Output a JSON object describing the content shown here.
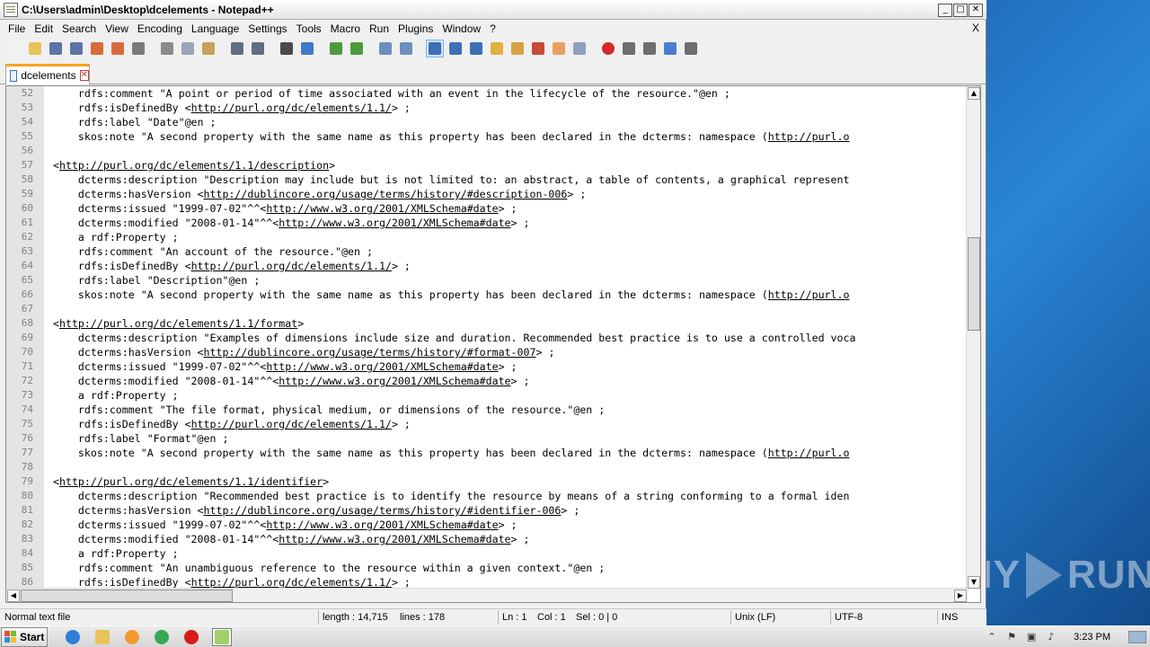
{
  "window": {
    "title": "C:\\Users\\admin\\Desktop\\dcelements - Notepad++",
    "buttons": {
      "minimize": "_",
      "maximize": "□",
      "close": "✕"
    }
  },
  "menubar": {
    "items": [
      "File",
      "Edit",
      "Search",
      "View",
      "Encoding",
      "Language",
      "Settings",
      "Tools",
      "Macro",
      "Run",
      "Plugins",
      "Window",
      "?"
    ],
    "close_doc": "X"
  },
  "toolbar": {
    "icons": [
      "new-file-icon",
      "open-file-icon",
      "save-icon",
      "save-all-icon",
      "close-icon",
      "close-all-icon",
      "print-icon",
      "sep",
      "cut-icon",
      "copy-icon",
      "paste-icon",
      "sep",
      "undo-icon",
      "redo-icon",
      "sep",
      "find-icon",
      "replace-icon",
      "sep",
      "zoom-in-icon",
      "zoom-out-icon",
      "sep",
      "sync-v-icon",
      "sync-h-icon",
      "sep",
      "word-wrap-icon",
      "all-chars-icon",
      "indent-guide-icon",
      "udl-icon",
      "doc-map-icon",
      "function-list-icon",
      "folder-workspace-icon",
      "monitor-icon",
      "sep",
      "record-macro-icon",
      "stop-macro-icon",
      "play-macro-icon",
      "run-multiple-macro-icon",
      "save-macro-icon"
    ],
    "colors": {
      "new-file-icon": "#f2f2f2",
      "open-file-icon": "#e8c35a",
      "save-icon": "#5a74a8",
      "save-all-icon": "#5a74a8",
      "close-icon": "#d86a3f",
      "close-all-icon": "#d86a3f",
      "print-icon": "#7a7a7a",
      "cut-icon": "#8a8a8a",
      "copy-icon": "#9aa6b8",
      "paste-icon": "#c7a05b",
      "undo-icon": "#5f6f86",
      "redo-icon": "#5f6f86",
      "find-icon": "#4a4a4a",
      "replace-icon": "#3f79c9",
      "zoom-in-icon": "#4e9a3c",
      "zoom-out-icon": "#4e9a3c",
      "sync-v-icon": "#6d8fbf",
      "sync-h-icon": "#6d8fbf",
      "word-wrap-icon": "#3e6fb4",
      "all-chars-icon": "#3e6fb4",
      "indent-guide-icon": "#3e6fb4",
      "udl-icon": "#e0b040",
      "doc-map-icon": "#d8a040",
      "function-list-icon": "#c74b3a",
      "folder-workspace-icon": "#e8a060",
      "monitor-icon": "#8fa0c0",
      "record-macro-icon": "#d42a2a",
      "stop-macro-icon": "#6e6e6e",
      "play-macro-icon": "#6e6e6e",
      "run-multiple-macro-icon": "#4a7fd0",
      "save-macro-icon": "#6e6e6e"
    }
  },
  "tab": {
    "label": "dcelements",
    "close": "✕"
  },
  "editor": {
    "lines": [
      {
        "n": "52",
        "t": "    rdfs:comment \"A point or period of time associated with an event in the lifecycle of the resource.\"@en ;"
      },
      {
        "n": "53",
        "t": "    rdfs:isDefinedBy <",
        "u": "http://purl.org/dc/elements/1.1/",
        "a": "> ;"
      },
      {
        "n": "54",
        "t": "    rdfs:label \"Date\"@en ;"
      },
      {
        "n": "55",
        "t": "    skos:note \"A second property with the same name as this property has been declared in the dcterms: namespace (",
        "u": "http://purl.o",
        "a": ""
      },
      {
        "n": "56",
        "t": ""
      },
      {
        "n": "57",
        "t": "<",
        "u": "http://purl.org/dc/elements/1.1/description",
        "a": ">"
      },
      {
        "n": "58",
        "t": "    dcterms:description \"Description may include but is not limited to: an abstract, a table of contents, a graphical represent"
      },
      {
        "n": "59",
        "t": "    dcterms:hasVersion <",
        "u": "http://dublincore.org/usage/terms/history/#description-006",
        "a": "> ;"
      },
      {
        "n": "60",
        "t": "    dcterms:issued \"1999-07-02\"^^<",
        "u": "http://www.w3.org/2001/XMLSchema#date",
        "a": "> ;"
      },
      {
        "n": "61",
        "t": "    dcterms:modified \"2008-01-14\"^^<",
        "u": "http://www.w3.org/2001/XMLSchema#date",
        "a": "> ;"
      },
      {
        "n": "62",
        "t": "    a rdf:Property ;"
      },
      {
        "n": "63",
        "t": "    rdfs:comment \"An account of the resource.\"@en ;"
      },
      {
        "n": "64",
        "t": "    rdfs:isDefinedBy <",
        "u": "http://purl.org/dc/elements/1.1/",
        "a": "> ;"
      },
      {
        "n": "65",
        "t": "    rdfs:label \"Description\"@en ;"
      },
      {
        "n": "66",
        "t": "    skos:note \"A second property with the same name as this property has been declared in the dcterms: namespace (",
        "u": "http://purl.o",
        "a": ""
      },
      {
        "n": "67",
        "t": ""
      },
      {
        "n": "68",
        "t": "<",
        "u": "http://purl.org/dc/elements/1.1/format",
        "a": ">"
      },
      {
        "n": "69",
        "t": "    dcterms:description \"Examples of dimensions include size and duration. Recommended best practice is to use a controlled voca"
      },
      {
        "n": "70",
        "t": "    dcterms:hasVersion <",
        "u": "http://dublincore.org/usage/terms/history/#format-007",
        "a": "> ;"
      },
      {
        "n": "71",
        "t": "    dcterms:issued \"1999-07-02\"^^<",
        "u": "http://www.w3.org/2001/XMLSchema#date",
        "a": "> ;"
      },
      {
        "n": "72",
        "t": "    dcterms:modified \"2008-01-14\"^^<",
        "u": "http://www.w3.org/2001/XMLSchema#date",
        "a": "> ;"
      },
      {
        "n": "73",
        "t": "    a rdf:Property ;"
      },
      {
        "n": "74",
        "t": "    rdfs:comment \"The file format, physical medium, or dimensions of the resource.\"@en ;"
      },
      {
        "n": "75",
        "t": "    rdfs:isDefinedBy <",
        "u": "http://purl.org/dc/elements/1.1/",
        "a": "> ;"
      },
      {
        "n": "76",
        "t": "    rdfs:label \"Format\"@en ;"
      },
      {
        "n": "77",
        "t": "    skos:note \"A second property with the same name as this property has been declared in the dcterms: namespace (",
        "u": "http://purl.o",
        "a": ""
      },
      {
        "n": "78",
        "t": ""
      },
      {
        "n": "79",
        "t": "<",
        "u": "http://purl.org/dc/elements/1.1/identifier",
        "a": ">"
      },
      {
        "n": "80",
        "t": "    dcterms:description \"Recommended best practice is to identify the resource by means of a string conforming to a formal iden"
      },
      {
        "n": "81",
        "t": "    dcterms:hasVersion <",
        "u": "http://dublincore.org/usage/terms/history/#identifier-006",
        "a": "> ;"
      },
      {
        "n": "82",
        "t": "    dcterms:issued \"1999-07-02\"^^<",
        "u": "http://www.w3.org/2001/XMLSchema#date",
        "a": "> ;"
      },
      {
        "n": "83",
        "t": "    dcterms:modified \"2008-01-14\"^^<",
        "u": "http://www.w3.org/2001/XMLSchema#date",
        "a": "> ;"
      },
      {
        "n": "84",
        "t": "    a rdf:Property ;"
      },
      {
        "n": "85",
        "t": "    rdfs:comment \"An unambiguous reference to the resource within a given context.\"@en ;"
      },
      {
        "n": "86",
        "t": "    rdfs:isDefinedBy <",
        "u": "http://purl.org/dc/elements/1.1/",
        "a": "> ;"
      }
    ]
  },
  "statusbar": {
    "file_type": "Normal text file",
    "length": "length : 14,715",
    "lines": "lines : 178",
    "ln": "Ln : 1",
    "col": "Col : 1",
    "sel": "Sel : 0 | 0",
    "eol": "Unix (LF)",
    "encoding": "UTF-8",
    "mode": "INS"
  },
  "taskbar": {
    "start_label": "Start",
    "apps": [
      "ie-icon",
      "explorer-icon",
      "media-player-icon",
      "chrome-icon",
      "opera-icon",
      "notepadpp-icon"
    ],
    "app_colors": {
      "ie-icon": "#2f7fd8",
      "explorer-icon": "#e8c35a",
      "media-player-icon": "#f29a2e",
      "chrome-icon": "#3aa757",
      "opera-icon": "#d81b1b",
      "notepadpp-icon": "#9fd06a"
    },
    "clock": "3:23 PM"
  },
  "watermark": {
    "left": "ANY",
    "right": "RUN"
  }
}
